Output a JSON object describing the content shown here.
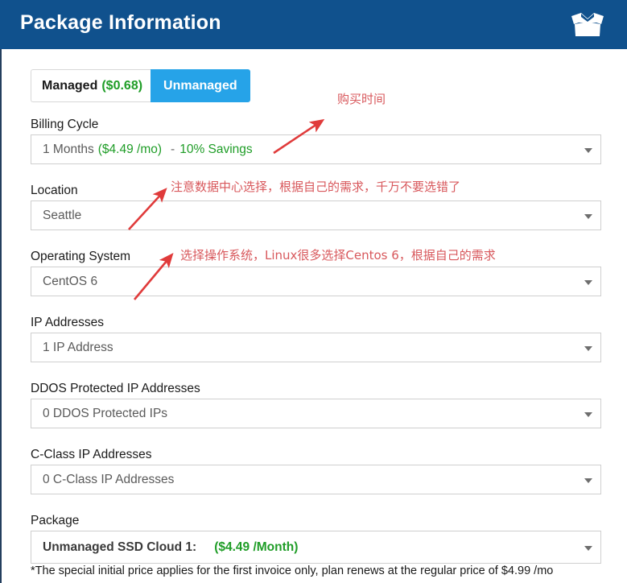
{
  "header": {
    "title": "Package Information",
    "icon": "open-box-icon",
    "background_color": "#10518d"
  },
  "toggle": {
    "managed_label": "Managed",
    "managed_price": "($0.68)",
    "unmanaged_label": "Unmanaged",
    "active": "Unmanaged",
    "active_color": "#26a3e8",
    "price_color": "#1f9d27"
  },
  "fields": {
    "billing_cycle": {
      "label": "Billing Cycle",
      "value_term": "1 Months",
      "value_price": "($4.49 /mo)",
      "value_dash": "-",
      "value_savings": "10% Savings"
    },
    "location": {
      "label": "Location",
      "value": "Seattle"
    },
    "operating_system": {
      "label": "Operating System",
      "value": "CentOS 6"
    },
    "ip_addresses": {
      "label": "IP Addresses",
      "value": "1 IP Address"
    },
    "ddos_ip_addresses": {
      "label": "DDOS Protected IP Addresses",
      "value": "0 DDOS Protected IPs"
    },
    "c_class_ip_addresses": {
      "label": "C-Class IP Addresses",
      "value": "0 C-Class IP Addresses"
    },
    "package": {
      "label": "Package",
      "value_name": "Unmanaged SSD Cloud 1:",
      "value_price": "($4.49 /Month)"
    }
  },
  "disclaimer": "*The special initial price applies for the first invoice only, plan renews at the regular price of $4.99 /mo",
  "annotations": {
    "color": "#d8585c",
    "items": [
      {
        "text": "购买时间"
      },
      {
        "text": "注意数据中心选择，根据自己的需求，千万不要选错了"
      },
      {
        "text": "选择操作系统，Linux很多选择Centos 6，根据自己的需求"
      }
    ]
  }
}
